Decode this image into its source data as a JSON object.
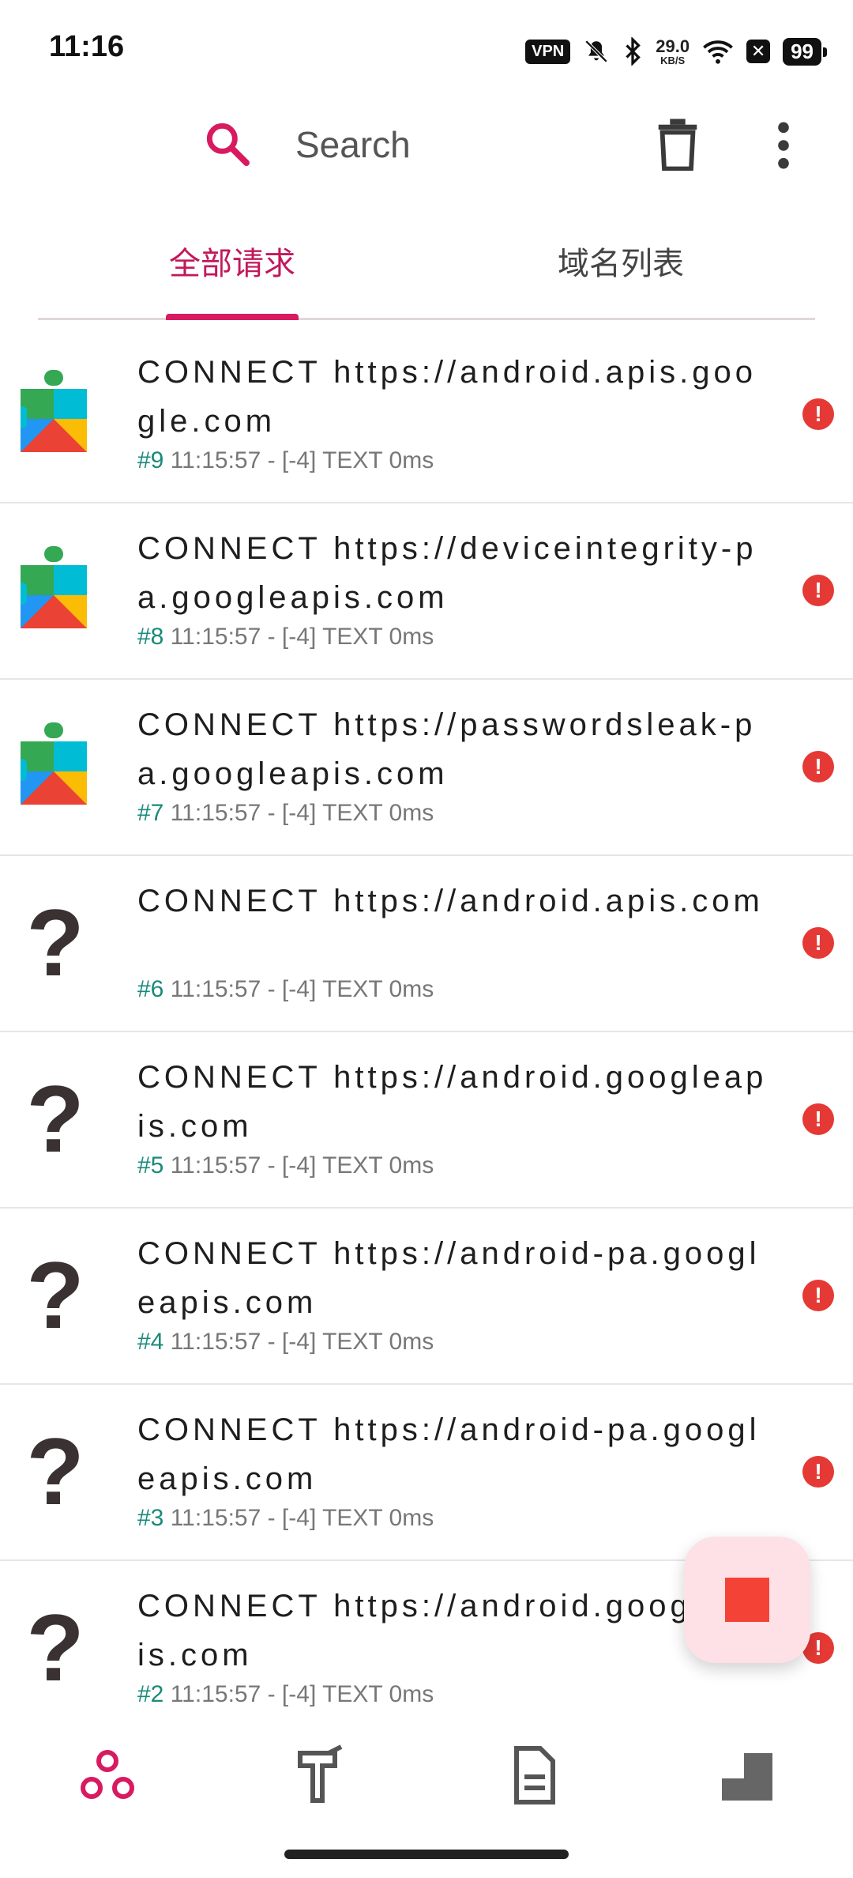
{
  "status_bar": {
    "time": "11:16",
    "vpn": "VPN",
    "net_speed_value": "29.0",
    "net_speed_unit": "KB/S",
    "battery": "99"
  },
  "toolbar": {
    "search_placeholder": "Search"
  },
  "tabs": [
    {
      "label": "全部请求",
      "active": true
    },
    {
      "label": "域名列表",
      "active": false
    }
  ],
  "requests": [
    {
      "app": "puzzle",
      "url": "CONNECT https://android.apis.google.com",
      "num": "#9",
      "meta": "11:15:57 - [-4] TEXT  0ms",
      "error": true
    },
    {
      "app": "puzzle",
      "url": "CONNECT https://deviceintegrity-pa.googleapis.com",
      "num": "#8",
      "meta": "11:15:57 - [-4] TEXT  0ms",
      "error": true
    },
    {
      "app": "puzzle",
      "url": "CONNECT https://passwordsleak-pa.googleapis.com",
      "num": "#7",
      "meta": "11:15:57 - [-4] TEXT  0ms",
      "error": true
    },
    {
      "app": "unknown",
      "url": "CONNECT https://android.apis.com",
      "num": "#6",
      "meta": "11:15:57 - [-4] TEXT  0ms",
      "error": true
    },
    {
      "app": "unknown",
      "url": "CONNECT https://android.googleapis.com",
      "num": "#5",
      "meta": "11:15:57 - [-4] TEXT  0ms",
      "error": true
    },
    {
      "app": "unknown",
      "url": "CONNECT https://android-pa.googleapis.com",
      "num": "#4",
      "meta": "11:15:57 - [-4] TEXT  0ms",
      "error": true
    },
    {
      "app": "unknown",
      "url": "CONNECT https://android-pa.googleapis.com",
      "num": "#3",
      "meta": "11:15:57 - [-4] TEXT  0ms",
      "error": true
    },
    {
      "app": "unknown",
      "url": "CONNECT https://android.googleapis.com",
      "num": "#2",
      "meta": "11:15:57 - [-4] TEXT  0ms",
      "error": true
    }
  ],
  "colors": {
    "accent": "#d81b60",
    "error": "#e53935",
    "request_number": "#1a8a7a"
  },
  "bottom_nav": [
    {
      "icon": "network-icon",
      "active": true
    },
    {
      "icon": "tools-icon",
      "active": false
    },
    {
      "icon": "document-icon",
      "active": false
    },
    {
      "icon": "stairs-icon",
      "active": false
    }
  ]
}
